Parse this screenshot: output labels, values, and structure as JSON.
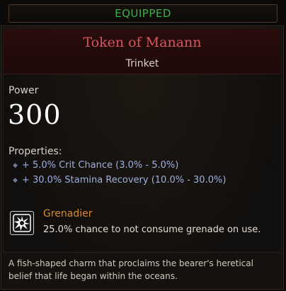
{
  "banner": {
    "label": "EQUIPPED"
  },
  "item": {
    "name": "Token of Manann",
    "type": "Trinket",
    "power_label": "Power",
    "power_value": "300",
    "properties_label": "Properties:",
    "properties": [
      {
        "text": "+ 5.0% Crit Chance (3.0% - 5.0%)"
      },
      {
        "text": "+ 30.0% Stamina Recovery (10.0% - 30.0%)"
      }
    ],
    "perk": {
      "icon": "grenade-burst-icon",
      "name": "Grenadier",
      "description": "25.0% chance to not consume grenade on use."
    },
    "flavor_text": "A fish-shaped charm that proclaims the bearer's heretical belief that life began within the oceans."
  },
  "colors": {
    "equipped": "#3fae49",
    "item_name": "#d9555a",
    "property": "#9fb0e0",
    "perk_name": "#d88a2c"
  }
}
